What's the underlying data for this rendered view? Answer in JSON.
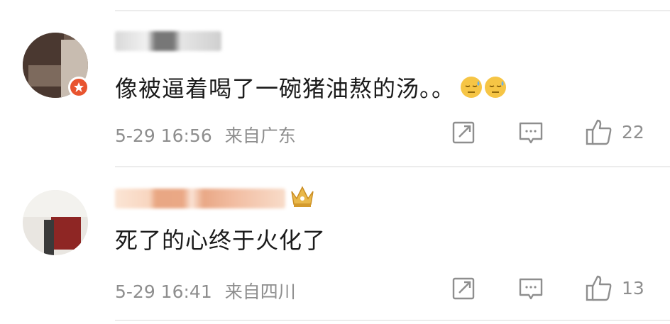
{
  "comments": [
    {
      "text": "像被逼着喝了一碗猪油熬的汤。。",
      "emojis": [
        "sweat-face-icon",
        "sweat-face-icon"
      ],
      "date": "5-29 16:56",
      "location": "来自广东",
      "likes": "22",
      "badge": "verified-badge-icon"
    },
    {
      "text": "死了的心终于火化了",
      "date": "5-29 16:41",
      "location": "来自四川",
      "likes": "13",
      "badge": "crown-icon"
    }
  ],
  "colors": {
    "text": "#1b1b1b",
    "meta": "#8e8e8e",
    "badge": "#e8542f",
    "divider": "#ececec"
  }
}
